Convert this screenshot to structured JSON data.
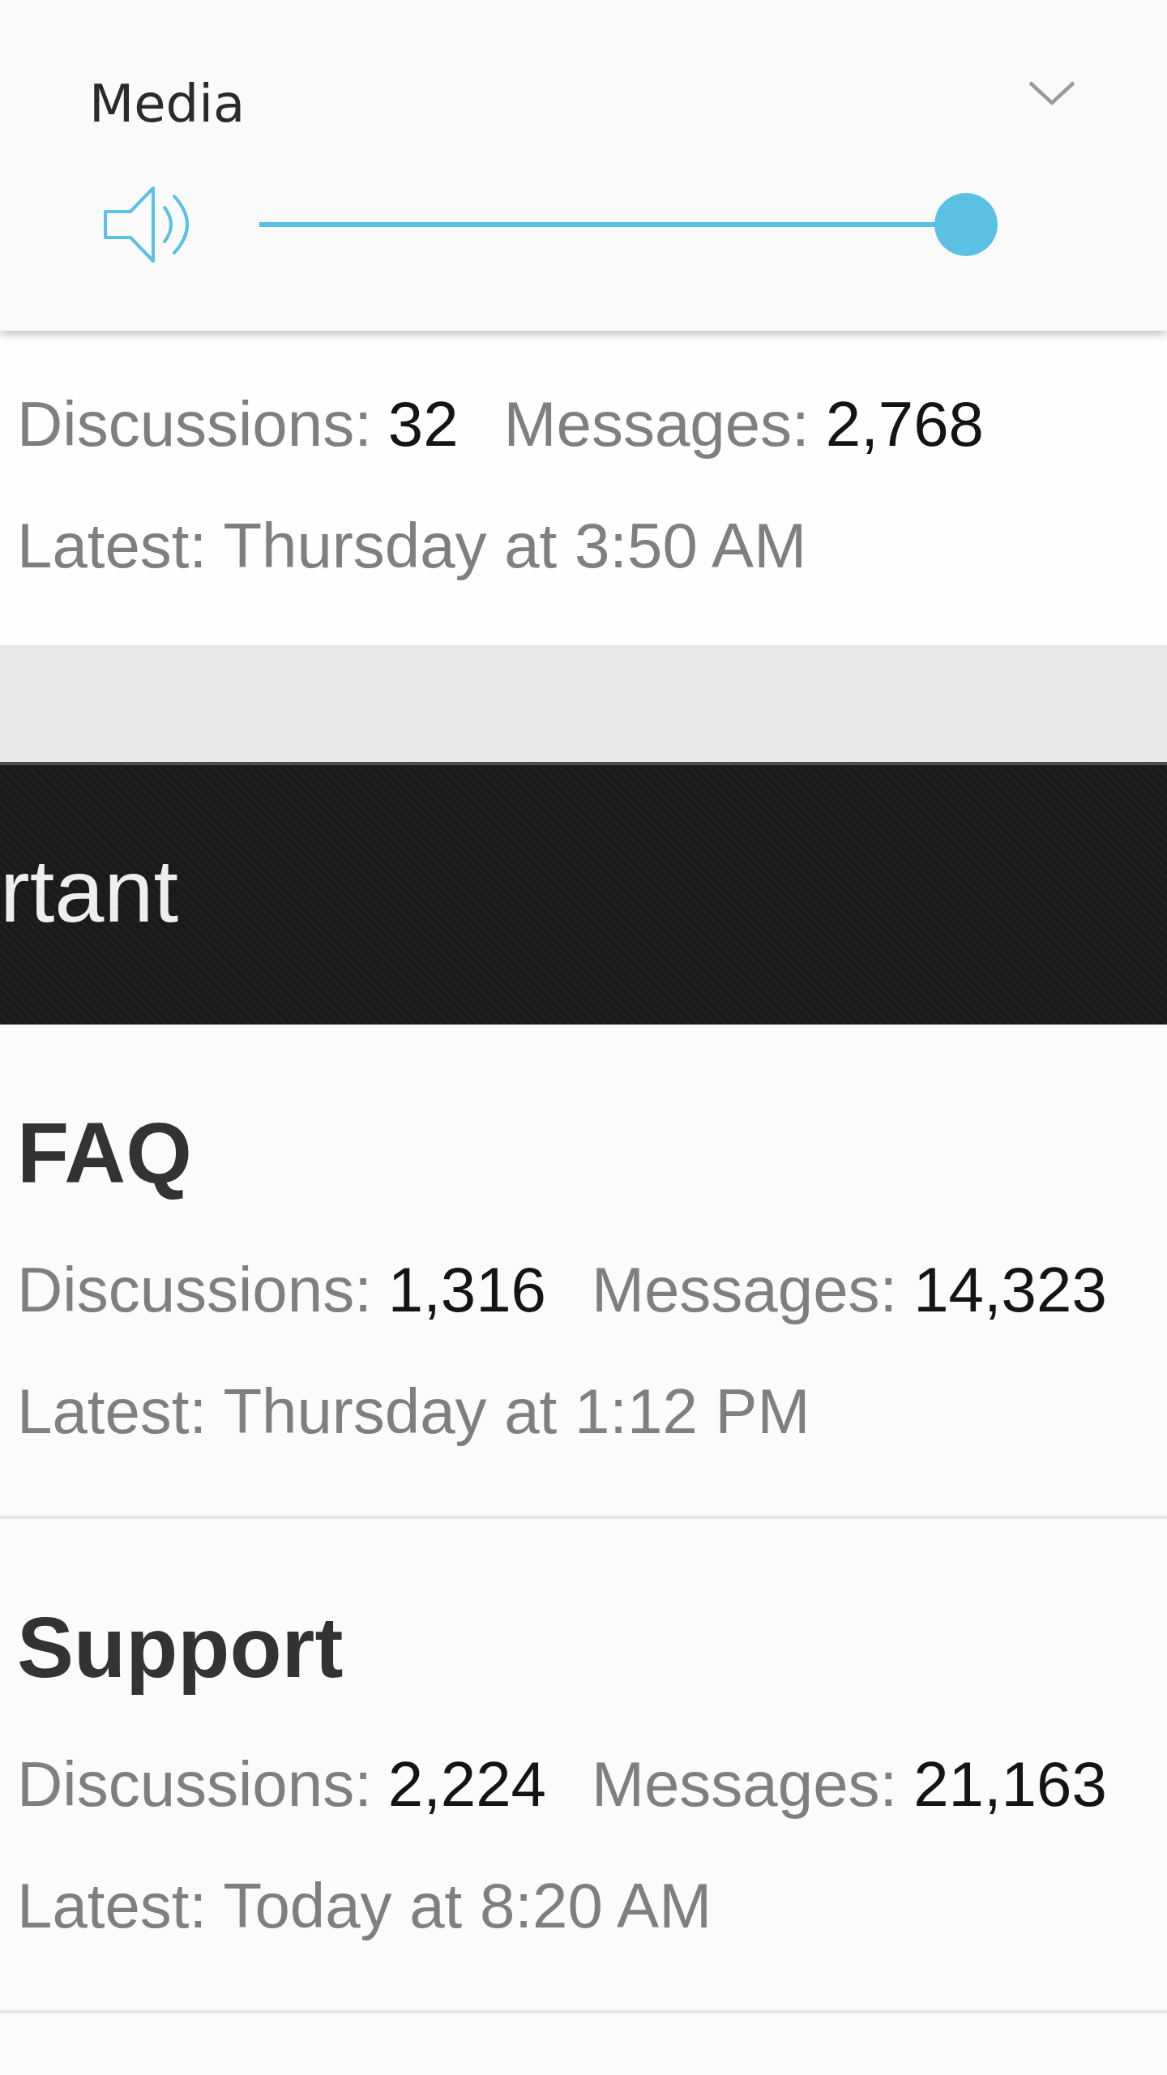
{
  "volume_panel": {
    "title": "Media",
    "slider": {
      "level": 1
    }
  },
  "nodes": [
    {
      "kind": "forum",
      "discussions_label": "Discussions:",
      "discussions": "32",
      "messages_label": "Messages:",
      "messages": "2,768",
      "latest": "Latest: Thursday at 3:50 AM"
    },
    {
      "kind": "category",
      "title": "rtant"
    },
    {
      "kind": "forum",
      "title": "FAQ",
      "discussions_label": "Discussions:",
      "discussions": "1,316",
      "messages_label": "Messages:",
      "messages": "14,323",
      "latest": "Latest: Thursday at 1:12 PM"
    },
    {
      "kind": "forum",
      "title": "Support",
      "discussions_label": "Discussions:",
      "discussions": "2,224",
      "messages_label": "Messages:",
      "messages": "21,163",
      "latest": "Latest: Today at 8:20 AM"
    }
  ]
}
